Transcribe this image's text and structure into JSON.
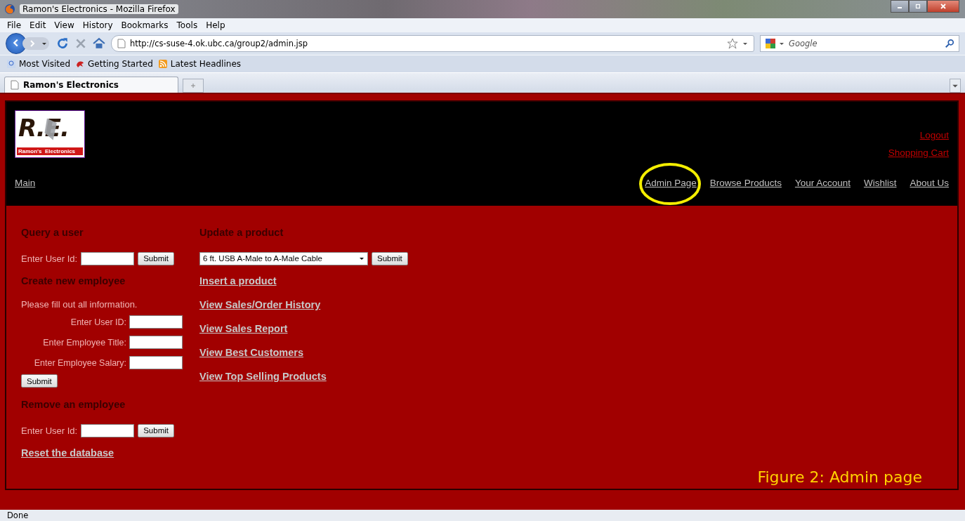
{
  "window": {
    "title": "Ramon's Electronics - Mozilla Firefox"
  },
  "menu_bar": [
    "File",
    "Edit",
    "View",
    "History",
    "Bookmarks",
    "Tools",
    "Help"
  ],
  "address_bar": {
    "url": "http://cs-suse-4.ok.ubc.ca/group2/admin.jsp"
  },
  "search_field": {
    "placeholder": "Google"
  },
  "bookmarks": [
    "Most Visited",
    "Getting Started",
    "Latest Headlines"
  ],
  "tabs": [
    {
      "label": "Ramon's Electronics",
      "selected": true
    }
  ],
  "page": {
    "logo": {
      "initials": "R.E.",
      "tagline": "Ramon's  Electronics"
    },
    "account_links": [
      "Logout",
      "Shopping Cart"
    ],
    "home_link": "Main",
    "nav_links": [
      {
        "label": "Admin Page",
        "highlighted": true
      },
      {
        "label": "Browse Products",
        "highlighted": false
      },
      {
        "label": "Your Account",
        "highlighted": false
      },
      {
        "label": "Wishlist",
        "highlighted": false
      },
      {
        "label": "About Us",
        "highlighted": false
      }
    ],
    "query_user": {
      "heading": "Query a user",
      "label": "Enter User Id:",
      "button": "Submit"
    },
    "create_employee": {
      "heading": "Create new employee",
      "note": "Please fill out all information.",
      "fields": [
        "Enter User ID:",
        "Enter Employee Title:",
        "Enter Employee Salary:"
      ],
      "button": "Submit"
    },
    "remove_employee": {
      "heading": "Remove an employee",
      "label": "Enter User Id:",
      "button": "Submit"
    },
    "reset_link": "Reset the database",
    "update_product": {
      "heading": "Update a product",
      "value": "6 ft. USB A-Male to A-Male Cable",
      "button": "Submit"
    },
    "product_links": [
      "Insert a product",
      "View Sales/Order History",
      "View Sales Report",
      "View Best Customers",
      "View Top Selling Products"
    ]
  },
  "caption": "Figure 2: Admin page",
  "status_bar": "Done"
}
